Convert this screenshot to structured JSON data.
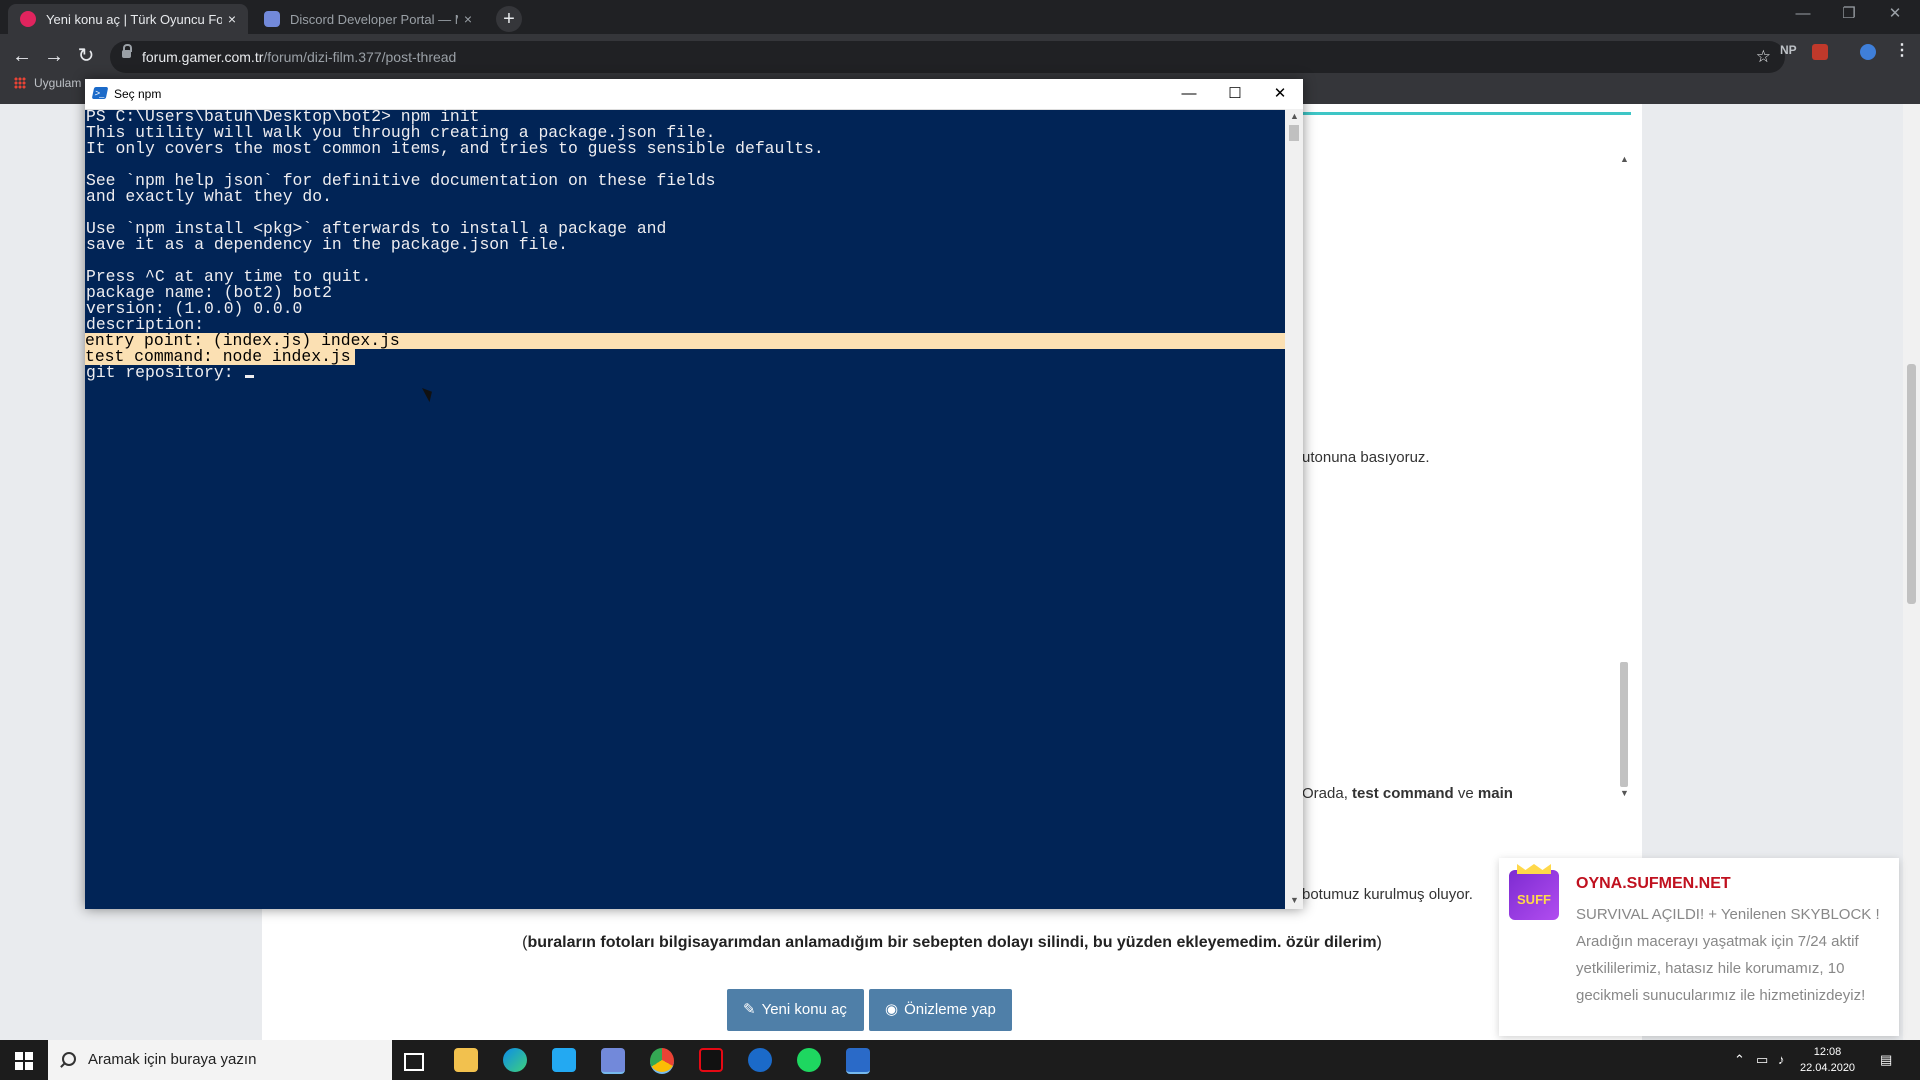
{
  "browser": {
    "tabs": [
      {
        "title": "Yeni konu aç | Türk Oyuncu Forumu",
        "active": true,
        "close": "×"
      },
      {
        "title": "Discord Developer Portal — My Applications",
        "active": false,
        "close": "×"
      }
    ],
    "new_tab": "+",
    "url_host": "forum.gamer.com.tr",
    "url_path": "/forum/dizi-film.377/post-thread",
    "bookmarks_label": "Uygulam",
    "ext_np": "NP"
  },
  "page": {
    "snippet_1": "utonuna basıyoruz.",
    "snippet_2_prefix": "Orada, ",
    "snippet_2_bold1": "test command",
    "snippet_2_mid": " ve ",
    "snippet_2_bold2": "main",
    "snippet_3": "botumuz kurulmuş oluyor.",
    "photo_note_open": "(",
    "photo_note_bold": "buraların fotoları bilgisayarımdan anlamadığım bir sebepten dolayı silindi, bu yüzden ekleyemedim. özür dilerim",
    "photo_note_close": ")",
    "btn_new_thread": "Yeni konu aç",
    "btn_preview": "Önizleme yap"
  },
  "ad": {
    "logo_text": "SUFF",
    "title": "OYNA.SUFMEN.NET",
    "text": "SURVIVAL AÇILDI! + Yenilenen SKYBLOCK ! Aradığın macerayı yaşatmak için 7/24 aktif yetkililerimiz, hatasız hile korumamız, 10 gecikmeli sunucularımız ile hizmetinizdeyiz!"
  },
  "terminal": {
    "title": "Seç npm",
    "lines": [
      "PS C:\\Users\\batuh\\Desktop\\bot2> npm init",
      "This utility will walk you through creating a package.json file.",
      "It only covers the most common items, and tries to guess sensible defaults.",
      "",
      "See `npm help json` for definitive documentation on these fields",
      "and exactly what they do.",
      "",
      "Use `npm install <pkg>` afterwards to install a package and",
      "save it as a dependency in the package.json file.",
      "",
      "Press ^C at any time to quit.",
      "package name: (bot2) bot2",
      "version: (1.0.0) 0.0.0",
      "description:",
      "entry point: (index.js) index.js",
      "test command: node index.js",
      "git repository: "
    ]
  },
  "taskbar": {
    "search_placeholder": "Aramak için buraya yazın",
    "time": "12:08",
    "date": "22.04.2020"
  },
  "colors": {
    "terminal_bg": "#012456",
    "terminal_fg": "#eeedf0",
    "selection": "#fbe0b3",
    "button_blue": "#4f7fa8",
    "ad_title": "#c0111f"
  }
}
